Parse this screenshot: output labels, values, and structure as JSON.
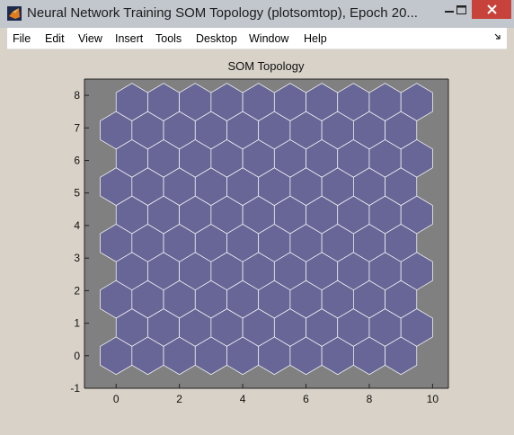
{
  "window": {
    "title": "Neural Network Training SOM Topology (plotsomtop), Epoch 20..."
  },
  "menu": {
    "items": [
      {
        "label": "File"
      },
      {
        "label": "Edit"
      },
      {
        "label": "View"
      },
      {
        "label": "Insert"
      },
      {
        "label": "Tools"
      },
      {
        "label": "Desktop"
      },
      {
        "label": "Window"
      },
      {
        "label": "Help"
      }
    ]
  },
  "colors": {
    "axes_background": "#808080",
    "neuron_fill": "#676696",
    "neuron_edge": "#ffffff",
    "close_button": "#c7423a"
  },
  "chart_data": {
    "type": "scatter",
    "title": "SOM Topology",
    "xlabel": "",
    "ylabel": "",
    "xlim": [
      -1,
      10.5
    ],
    "ylim": [
      -1,
      8.5
    ],
    "xticks": [
      0,
      2,
      4,
      6,
      8,
      10
    ],
    "yticks": [
      -1,
      0,
      1,
      2,
      3,
      4,
      5,
      6,
      7,
      8
    ],
    "topology": "hexagonal",
    "grid_size": [
      10,
      10
    ],
    "neurons": {
      "rows": [
        {
          "y": 0,
          "x": [
            0,
            1,
            2,
            3,
            4,
            5,
            6,
            7,
            8,
            9
          ]
        },
        {
          "y": 0.866,
          "x": [
            0.5,
            1.5,
            2.5,
            3.5,
            4.5,
            5.5,
            6.5,
            7.5,
            8.5,
            9.5
          ]
        },
        {
          "y": 1.732,
          "x": [
            0,
            1,
            2,
            3,
            4,
            5,
            6,
            7,
            8,
            9
          ]
        },
        {
          "y": 2.598,
          "x": [
            0.5,
            1.5,
            2.5,
            3.5,
            4.5,
            5.5,
            6.5,
            7.5,
            8.5,
            9.5
          ]
        },
        {
          "y": 3.464,
          "x": [
            0,
            1,
            2,
            3,
            4,
            5,
            6,
            7,
            8,
            9
          ]
        },
        {
          "y": 4.33,
          "x": [
            0.5,
            1.5,
            2.5,
            3.5,
            4.5,
            5.5,
            6.5,
            7.5,
            8.5,
            9.5
          ]
        },
        {
          "y": 5.196,
          "x": [
            0,
            1,
            2,
            3,
            4,
            5,
            6,
            7,
            8,
            9
          ]
        },
        {
          "y": 6.062,
          "x": [
            0.5,
            1.5,
            2.5,
            3.5,
            4.5,
            5.5,
            6.5,
            7.5,
            8.5,
            9.5
          ]
        },
        {
          "y": 6.928,
          "x": [
            0,
            1,
            2,
            3,
            4,
            5,
            6,
            7,
            8,
            9
          ]
        },
        {
          "y": 7.794,
          "x": [
            0.5,
            1.5,
            2.5,
            3.5,
            4.5,
            5.5,
            6.5,
            7.5,
            8.5,
            9.5
          ]
        }
      ]
    }
  }
}
